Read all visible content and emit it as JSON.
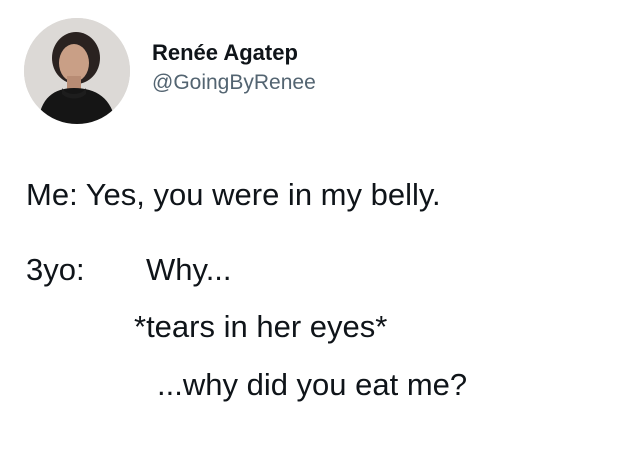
{
  "author": {
    "display_name": "Renée Agatep",
    "handle": "@GoingByRenee"
  },
  "tweet": {
    "line1": "Me: Yes, you were in my belly.",
    "line2_speaker": "3yo:",
    "line2_text": "Why...",
    "line3": "*tears in her eyes*",
    "line4": "...why did you eat me?"
  },
  "colors": {
    "text": "#0f1419",
    "handle": "#536471",
    "background": "#ffffff"
  }
}
